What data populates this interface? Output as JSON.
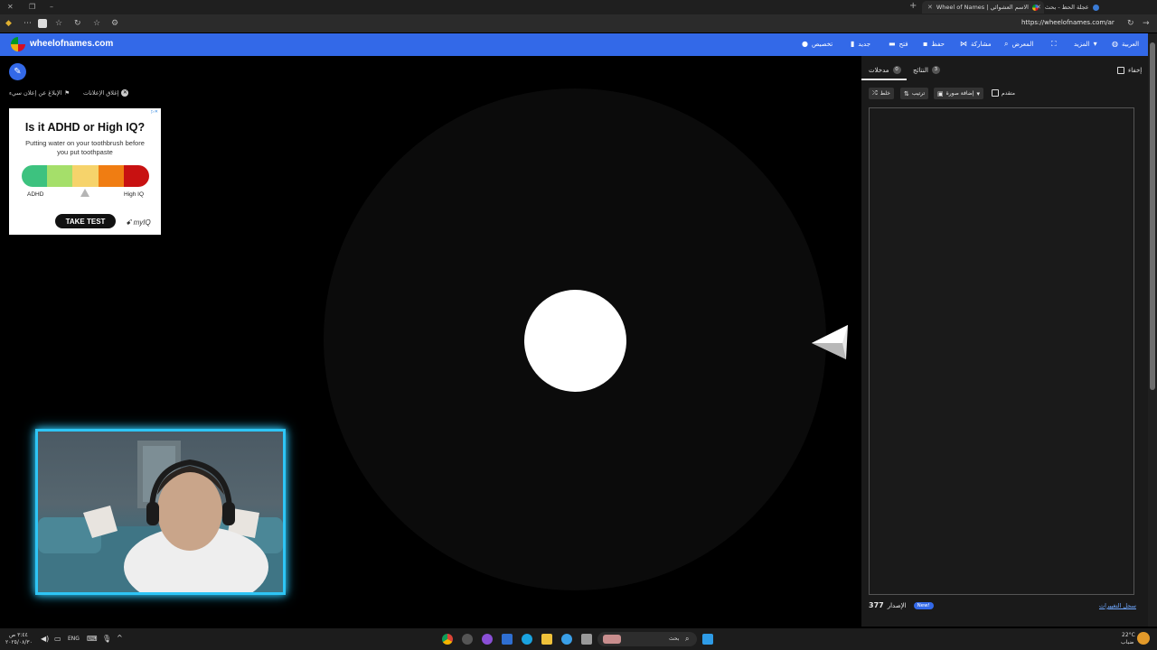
{
  "browser": {
    "tabs": [
      {
        "title": "عجلة الحظ - بحث"
      },
      {
        "title": "Wheel of Names | الاسم العشوائي"
      }
    ],
    "url": "https://wheelofnames.com/ar"
  },
  "site": {
    "name": "wheelofnames.com",
    "nav": {
      "customize": "تخصيص",
      "new": "جديد",
      "open": "فتح",
      "save": "حفظ",
      "share": "مشاركة",
      "gallery": "المعرض",
      "more": "المزيد",
      "language": "العربية"
    }
  },
  "ad_links": {
    "close_ads": "إغلاق الإعلانات",
    "report_ad": "الإبلاغ عن إعلان سيء"
  },
  "ad": {
    "title": "Is it ADHD or High IQ?",
    "subtitle": "Putting water on your toothbrush before you put toothpaste",
    "label_left": "ADHD",
    "label_right": "High IQ",
    "cta": "TAKE TEST",
    "brand": "myIQ",
    "bar_colors": [
      "#3dc27f",
      "#a5df6a",
      "#f6d36b",
      "#f07d12",
      "#c81111"
    ]
  },
  "panel": {
    "tabs": {
      "entries": {
        "label": "مدخلات",
        "count": "0"
      },
      "results": {
        "label": "النتائج",
        "count": "3"
      }
    },
    "hide_label": "إخفاء",
    "toolbar": {
      "shuffle": "خلط",
      "sort": "ترتيب",
      "add_image": "إضافة صورة"
    },
    "advanced_label": "متقدم",
    "version_label": "الإصدار",
    "version_number": "377",
    "new_badge": "New!",
    "changelog": "سجل التغييرات"
  },
  "taskbar": {
    "weather_temp": "22°C",
    "weather_desc": "ضباب",
    "search_placeholder": "بحث",
    "lang": "ENG",
    "time": "٣:٤٤ ص",
    "date": "٢٠٢٥/٠٨/٣٠"
  },
  "colors": {
    "brand_blue": "#3369e8",
    "webcam_border": "#2ec5f5"
  }
}
